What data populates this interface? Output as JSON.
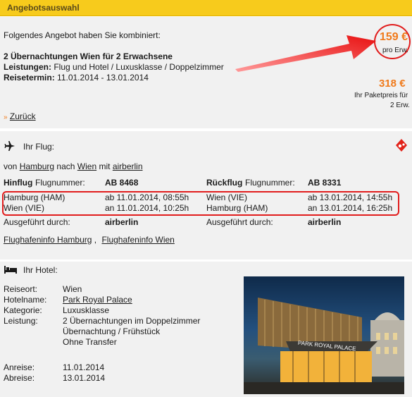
{
  "header": {
    "title": "Angebotsauswahl"
  },
  "offer": {
    "intro": "Folgendes Angebot haben Sie kombiniert:",
    "title": "2 Übernachtungen Wien für 2 Erwachsene",
    "services_label": "Leistungen:",
    "services_value": "Flug und Hotel / Luxusklasse / Doppelzimmer",
    "date_label": "Reisetermin:",
    "date_value": "11.01.2014 - 13.01.2014",
    "price_per_person": "159 €",
    "price_per_person_label": "pro Erw.",
    "total_price": "318 €",
    "total_label_1": "Ihr Paketpreis für",
    "total_label_2": "2 Erw.",
    "back_link": "Zurück",
    "back_icon": "»"
  },
  "flight": {
    "heading": "Ihr Flug:",
    "route_prefix": "von",
    "from_city": "Hamburg",
    "to_word": "nach",
    "to_city": "Wien",
    "with_word": "mit",
    "airline_link": "airberlin",
    "outbound_label": "Hinflug",
    "flightnum_label": "Flugnummer:",
    "outbound_number": "AB 8468",
    "return_label": "Rückflug",
    "return_number": "AB 8331",
    "rows": [
      {
        "from": "Hamburg (HAM)",
        "dep": "ab 11.01.2014, 08:55h",
        "to": "Wien (VIE)",
        "ret_dep": "ab 13.01.2014, 14:55h"
      },
      {
        "from": "Wien (VIE)",
        "dep": "an 11.01.2014, 10:25h",
        "to": "Hamburg (HAM)",
        "ret_dep": "an 13.01.2014, 16:25h"
      }
    ],
    "operated_label": "Ausgeführt durch:",
    "operated_value": "airberlin",
    "airport_info_1": "Flughafeninfo Hamburg",
    "airport_sep": ",",
    "airport_info_2": "Flughafeninfo Wien"
  },
  "hotel": {
    "heading": "Ihr Hotel:",
    "rows": [
      {
        "label": "Reiseort:",
        "value": "Wien"
      },
      {
        "label": "Hotelname:",
        "value": "Park Royal Palace"
      },
      {
        "label": "Kategorie:",
        "value": "Luxusklasse"
      },
      {
        "label": "Leistung:",
        "value": "2 Übernachtungen im Doppelzimmer"
      }
    ],
    "leistung_extra_1": "Übernachtung / Frühstück",
    "leistung_extra_2": "Ohne Transfer",
    "arrival_label": "Anreise:",
    "arrival_value": "11.01.2014",
    "departure_label": "Abreise:",
    "departure_value": "13.01.2014",
    "image_sign": "PARK ROYAL PALACE"
  },
  "colors": {
    "header": "#f7cb1c",
    "accent_orange": "#f07a1b",
    "highlight_red": "#e11d1d",
    "panel": "#f1f1f1"
  }
}
